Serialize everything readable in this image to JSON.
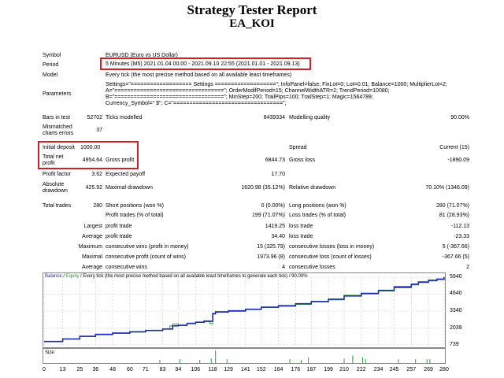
{
  "report": {
    "title": "Strategy Tester Report",
    "subtitle": "EA_KOI"
  },
  "settings": {
    "symbol_label": "Symbol",
    "symbol_value": "EURUSD (Euro vs US Dollar)",
    "period_label": "Period",
    "period_value": "5 Minutes (M5) 2021.01.04 00:00 - 2021.09.10 22:55 (2021.01.01 - 2021.09.13)",
    "model_label": "Model",
    "model_value": "Every tick (the most precise method based on all available least timeframes)",
    "parameters_label": "Parameters",
    "parameters_lines": [
      "Settings=\"=================== Settings ===================\"; InfoPanel=false; FixLot=0; Lot=0.01; Balance=1000; MultiplierLot=2;",
      "A=\"==================================\"; OrderModifPeriod=15; ChannelWidthATR=2; TrendPeriod=10080;",
      "B=\"==================================\"; MinStep=200; TrailPips=100; TrailStep=1; Magic=1564789;",
      "Currency_Symbol=\" $\"; C=\"==================================\";"
    ]
  },
  "stats": {
    "bars_label": "Bars in test",
    "bars_value": "52702",
    "ticks_label": "Ticks modelled",
    "ticks_value": "8439334",
    "quality_label": "Modelling quality",
    "quality_value": "90.00%",
    "mismatched_label_1": "Mismatched",
    "mismatched_label_2": "charts errors",
    "mismatched_value": "37",
    "initial_deposit_label": "Initial deposit",
    "initial_deposit_value": "1000.00",
    "spread_label": "Spread",
    "spread_value": "Current (15)",
    "net_profit_label_1": "Total net",
    "net_profit_label_2": "profit",
    "net_profit_value": "4954.64",
    "gross_profit_label": "Gross profit",
    "gross_profit_value": "6844.73",
    "gross_loss_label": "Gross loss",
    "gross_loss_value": "-1890.09",
    "profit_factor_label": "Profit factor",
    "profit_factor_value": "3.62",
    "expected_payoff_label": "Expected payoff",
    "expected_payoff_value": "17.70",
    "abs_dd_label_1": "Absolute",
    "abs_dd_label_2": "drawdown",
    "abs_dd_value": "425.92",
    "max_dd_label": "Maximal drawdown",
    "max_dd_value": "1620.98 (35.12%)",
    "rel_dd_label": "Relative drawdown",
    "rel_dd_value": "70.10% (1346.09)",
    "total_trades_label": "Total trades",
    "total_trades_value": "280",
    "short_label": "Short positions (won %)",
    "short_value": "0 (0.00%)",
    "long_label": "Long positions (won %)",
    "long_value": "280 (71.07%)",
    "profit_trades_label": "Profit trades (% of total)",
    "profit_trades_value": "199 (71.07%)",
    "loss_trades_label": "Loss trades (% of total)",
    "loss_trades_value": "81 (28.93%)",
    "largest_label": "Largest",
    "largest_profit_label": "profit trade",
    "largest_profit_value": "1419.25",
    "largest_loss_label": "loss trade",
    "largest_loss_value": "-112.13",
    "average_label": "Average",
    "average_profit_label": "profit trade",
    "average_profit_value": "34.40",
    "average_loss_label": "loss trade",
    "average_loss_value": "-23.33",
    "maximum_label": "Maximum",
    "max_cons_wins_label": "consecutive wins (profit in money)",
    "max_cons_wins_value": "15 (325.79)",
    "max_cons_losses_label": "consecutive losses (loss in money)",
    "max_cons_losses_value": "5 (-367.66)",
    "maximal_label": "Maximal",
    "maximal_cons_profit_label": "consecutive profit (count of wins)",
    "maximal_cons_profit_value": "1973.96 (8)",
    "maximal_cons_loss_label": "consecutive loss (count of losses)",
    "maximal_cons_loss_value": "-367.66 (5)",
    "avg_cons_label": "Average",
    "avg_cons_wins_label": "consecutive wins",
    "avg_cons_wins_value": "4",
    "avg_cons_losses_label": "consecutive losses",
    "avg_cons_losses_value": "2"
  },
  "chart_data": {
    "type": "line",
    "legend": {
      "balance": "Balance",
      "sep": " / ",
      "equity": "Equity",
      "text": " / Every tick (the most precise method based on all available least timeframes to generate each tick) / 90.00%"
    },
    "size_label": "Size",
    "colors": {
      "balance": "#1a2fb0",
      "equity": "#2aa02a",
      "size": "#2aa02a"
    },
    "ylim": [
      739,
      5940
    ],
    "y_ticks": [
      "5940",
      "4640",
      "3340",
      "2039",
      "739"
    ],
    "x_ticks": [
      "0",
      "13",
      "25",
      "36",
      "48",
      "60",
      "71",
      "83",
      "94",
      "106",
      "118",
      "129",
      "141",
      "152",
      "164",
      "176",
      "187",
      "199",
      "210",
      "222",
      "234",
      "245",
      "257",
      "269",
      "280"
    ],
    "xlim": [
      0,
      280
    ],
    "series": [
      {
        "key": "balance",
        "x": [
          0,
          13,
          25,
          36,
          48,
          60,
          71,
          83,
          90,
          94,
          100,
          106,
          112,
          116,
          118,
          120,
          129,
          141,
          152,
          164,
          176,
          187,
          199,
          210,
          222,
          234,
          245,
          257,
          262,
          269,
          275,
          280
        ],
        "values": [
          1000,
          1200,
          1400,
          1550,
          1650,
          1750,
          1850,
          1960,
          2200,
          2250,
          2380,
          2480,
          2550,
          2560,
          3150,
          3270,
          3360,
          3480,
          3640,
          3750,
          3900,
          4070,
          4250,
          4500,
          4700,
          4900,
          5200,
          5400,
          5550,
          5700,
          5780,
          5955
        ]
      },
      {
        "key": "equity",
        "x": [
          0,
          13,
          25,
          36,
          48,
          60,
          71,
          83,
          88,
          90,
          94,
          100,
          106,
          112,
          116,
          118,
          120,
          129,
          141,
          152,
          164,
          176,
          187,
          199,
          210,
          222,
          234,
          245,
          257,
          262,
          269,
          275,
          280
        ],
        "values": [
          1000,
          1180,
          1380,
          1520,
          1620,
          1720,
          1830,
          1950,
          2200,
          2350,
          2220,
          2420,
          2460,
          2600,
          2380,
          3100,
          3300,
          3320,
          3450,
          3610,
          3700,
          3850,
          4040,
          4200,
          4550,
          4650,
          4950,
          5120,
          5350,
          5600,
          5650,
          5820,
          5900
        ]
      }
    ],
    "size_bars": {
      "x": [
        81,
        95,
        109,
        117,
        120,
        128,
        172,
        180,
        185,
        210,
        216,
        223,
        225,
        248,
        260,
        268,
        270
      ],
      "values": [
        0.25,
        0.3,
        0.25,
        0.35,
        1.0,
        0.3,
        0.3,
        0.25,
        0.45,
        0.35,
        0.6,
        0.45,
        0.3,
        0.3,
        0.3,
        0.3,
        0.3
      ]
    }
  }
}
